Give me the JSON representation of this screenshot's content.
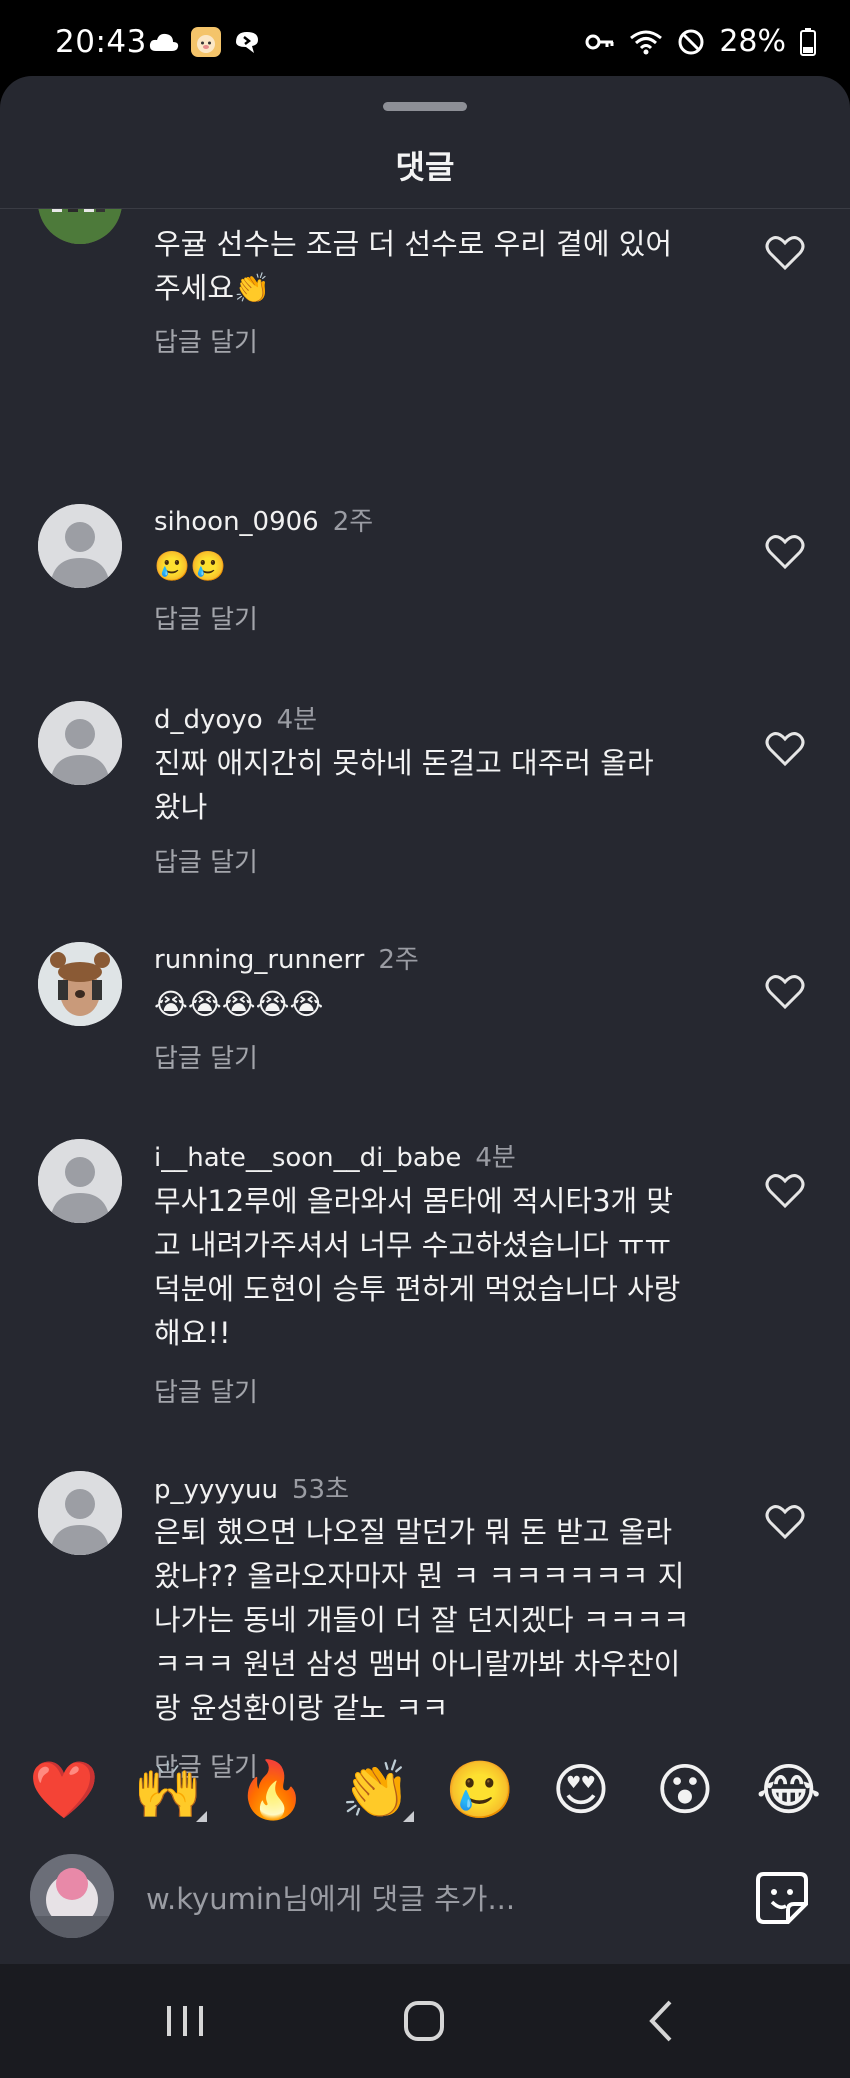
{
  "status_bar": {
    "time": "20:43",
    "battery": "28%",
    "left_icons": [
      "cloud-icon",
      "app-notification-icon",
      "alert-icon"
    ],
    "right_icons": [
      "key-icon",
      "wifi-icon",
      "do-not-disturb-icon",
      "battery-icon"
    ]
  },
  "sheet": {
    "title": "댓글"
  },
  "comments": [
    {
      "username": "",
      "time": "",
      "text": "우귤 선수는 조금 더 선수로 우리 곁에 있어주세요👏",
      "reply_label": "답글 달기"
    },
    {
      "username": "sihoon_0906",
      "time": "2주",
      "text": "🥲🥲",
      "reply_label": "답글 달기"
    },
    {
      "username": "d_dyoyo",
      "time": "4분",
      "text": "진짜 애지간히 못하네 돈걸고 대주러 올라왔나",
      "reply_label": "답글 달기"
    },
    {
      "username": "running_runnerr",
      "time": "2주",
      "text": "😭😭😭😭😭",
      "reply_label": "답글 달기"
    },
    {
      "username": "i__hate__soon__di_babe",
      "time": "4분",
      "text": "무사12루에 올라와서 몸타에 적시타3개 맞고 내려가주셔서 너무 수고하셨습니다 ㅠㅠ 덕분에 도현이 승투 편하게 먹었습니다 사랑해요!!",
      "reply_label": "답글 달기"
    },
    {
      "username": "p_yyyyuu",
      "time": "53초",
      "text": "은퇴 했으면 나오질 말던가 뭐 돈 받고 올라왔냐?? 올라오자마자 뭔 ㅋ ㅋㅋㅋㅋㅋㅋ 지나가는 동네 개들이 더 잘 던지겠다 ㅋㅋㅋㅋㅋㅋㅋ 원년 삼성 맴버 아니랄까봐 차우찬이랑 윤성환이랑 같노 ㅋㅋ",
      "reply_label": "답글 달기"
    }
  ],
  "emoji_bar": [
    "❤️",
    "🙌",
    "🔥",
    "👏",
    "🥲",
    "😍",
    "😮",
    "😂"
  ],
  "input": {
    "placeholder": "w.kyumin님에게 댓글 추가..."
  },
  "nav_bar": [
    "recent-apps-icon",
    "home-icon",
    "back-icon"
  ]
}
